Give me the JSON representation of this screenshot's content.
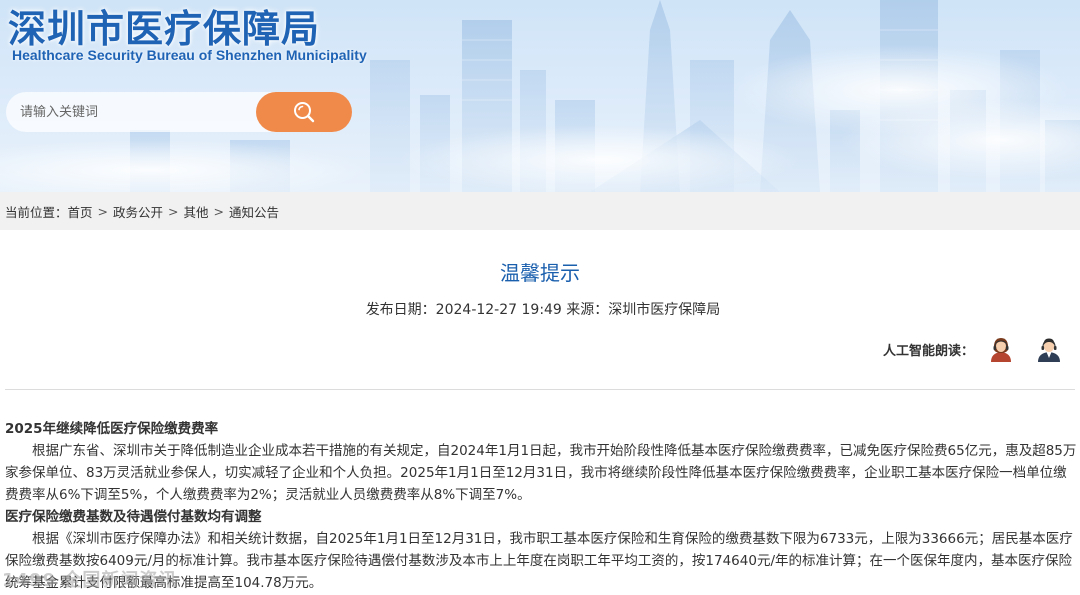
{
  "header": {
    "site_title": "深圳市医疗保障局",
    "site_subtitle": "Healthcare Security Bureau of Shenzhen Municipality"
  },
  "search": {
    "placeholder": "请输入关键词",
    "button_icon": "search-icon"
  },
  "breadcrumb": {
    "label": "当前位置：",
    "separator": ">",
    "items": [
      "首页",
      "政务公开",
      "其他",
      "通知公告"
    ]
  },
  "article": {
    "title": "温馨提示",
    "meta": "发布日期：2024-12-27 19:49 来源：深圳市医疗保障局",
    "tts_label": "人工智能朗读：",
    "tts_voices": [
      "female-voice-icon",
      "male-voice-icon"
    ],
    "sections": [
      {
        "heading": "2025年继续降低医疗保险缴费费率",
        "paragraph": "根据广东省、深圳市关于降低制造业企业成本若干措施的有关规定，自2024年1月1日起，我市开始阶段性降低基本医疗保险缴费费率，已减免医疗保险费65亿元，惠及超85万家参保单位、83万灵活就业参保人，切实减轻了企业和个人负担。2025年1月1日至12月31日，我市将继续阶段性降低基本医疗保险缴费费率，企业职工基本医疗保险一档单位缴费费率从6%下调至5%，个人缴费费率为2%；灵活就业人员缴费费率从8%下调至7%。"
      },
      {
        "heading": "医疗保险缴费基数及待遇偿付基数均有调整",
        "paragraph": "根据《深圳市医疗保障办法》和相关统计数据，自2025年1月1日至12月31日，我市职工基本医疗保险和生育保险的缴费基数下限为6733元，上限为33666元；居民基本医疗保险缴费基数按6409元/月的标准计算。我市基本医疗保险待遇偿付基数涉及本市上上年度在岗职工年平均工资的，按174640元/年的标准计算；在一个医保年度内，基本医疗保险统筹基金累计支付限额最高标准提高至104.78万元。"
      }
    ]
  },
  "watermark": "1499 全国新闻资讯",
  "colors": {
    "brand_blue": "#1f63b5",
    "title_blue": "#1a5fae",
    "search_orange": "#f08a4b",
    "breadcrumb_bg": "#f1f1f1"
  }
}
